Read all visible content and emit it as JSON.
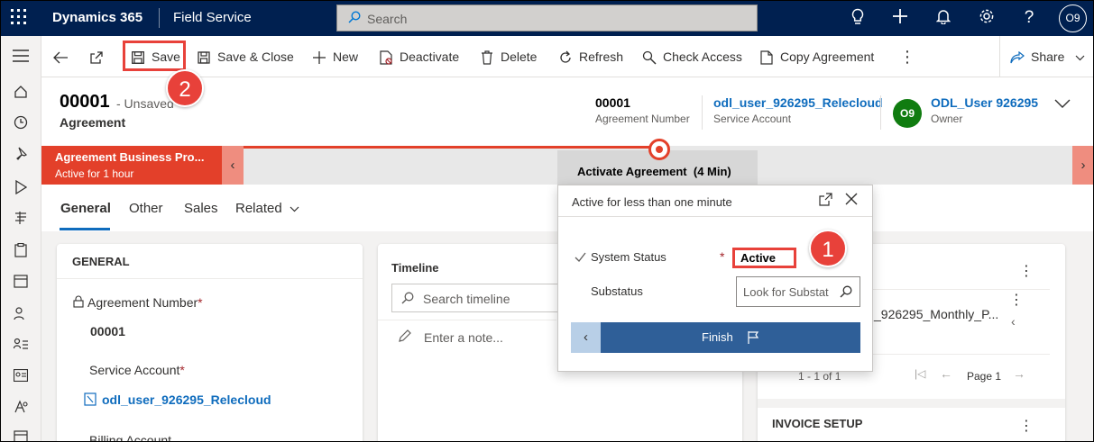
{
  "topbar": {
    "brand": "Dynamics 365",
    "app_name": "Field Service",
    "search_placeholder": "Search",
    "user_initials": "O9"
  },
  "commands": {
    "save": "Save",
    "save_close": "Save & Close",
    "new": "New",
    "deactivate": "Deactivate",
    "delete": "Delete",
    "refresh": "Refresh",
    "check_access": "Check Access",
    "copy_agreement": "Copy Agreement",
    "share": "Share"
  },
  "header": {
    "record_id": "00001",
    "unsaved": "- Unsaved",
    "record_type": "Agreement",
    "agreement_number_value": "00001",
    "agreement_number_label": "Agreement Number",
    "service_account_value": "odl_user_926295_Relecloud",
    "service_account_label": "Service Account",
    "owner_initials": "O9",
    "owner_value": "ODL_User 926295",
    "owner_label": "Owner"
  },
  "bpf": {
    "process_name": "Agreement Business Pro...",
    "process_duration": "Active for 1 hour",
    "stage_label": "Activate Agreement",
    "stage_duration": "(4 Min)"
  },
  "tabs": [
    "General",
    "Other",
    "Sales",
    "Related"
  ],
  "general": {
    "title": "GENERAL",
    "agreement_number_label": "Agreement Number",
    "agreement_number_value": "00001",
    "service_account_label": "Service Account",
    "service_account_value": "odl_user_926295_Relecloud",
    "billing_account_label": "Billing Account"
  },
  "timeline": {
    "title": "Timeline",
    "search_placeholder": "Search timeline",
    "note_placeholder": "Enter a note..."
  },
  "right_panel": {
    "subgrid_item": "_926295_Monthly_P...",
    "paging_count": "1 - 1 of 1",
    "page_label": "Page 1",
    "invoice_title": "INVOICE SETUP"
  },
  "flyout": {
    "header": "Active for less than one minute",
    "system_status_label": "System Status",
    "system_status_value": "Active",
    "substatus_label": "Substatus",
    "substatus_placeholder": "Look for Substatus",
    "finish_label": "Finish"
  },
  "badges": {
    "one": "1",
    "two": "2"
  },
  "colors": {
    "nav": "#002050",
    "accent_red": "#e3402a",
    "link": "#0f6cbd",
    "owner_avatar": "#107c10"
  }
}
